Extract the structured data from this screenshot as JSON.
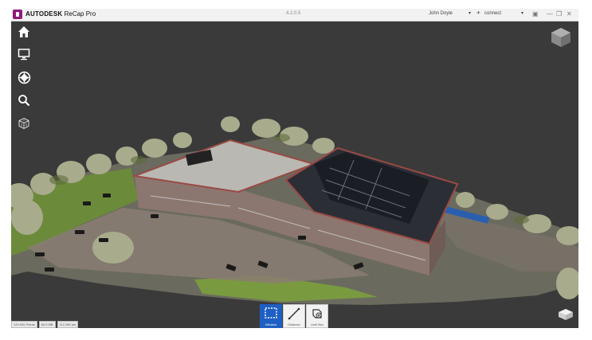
{
  "app": {
    "brand_name": "AUTODESK",
    "product_name": "ReCap Pro",
    "version": "4.2.0.5",
    "user": "John Doyle",
    "connect_label": "connect"
  },
  "status_bar": [
    "120.000 Points",
    "84.5 MB",
    "112.345 pts"
  ],
  "toolbar": [
    {
      "label": "Window",
      "icon": "selection-window-icon",
      "active": true
    },
    {
      "label": "Distance",
      "icon": "measure-distance-icon",
      "active": false
    },
    {
      "label": "Limit Box",
      "icon": "limit-box-icon",
      "active": false
    }
  ],
  "side_tools": [
    "home-icon",
    "monitor-icon",
    "navigation-wheel-icon",
    "search-icon",
    "point-cloud-icon"
  ],
  "colors": {
    "viewport": "#3a3a3a",
    "accent": "#1e5fc4",
    "brand": "#8f1a7a"
  }
}
